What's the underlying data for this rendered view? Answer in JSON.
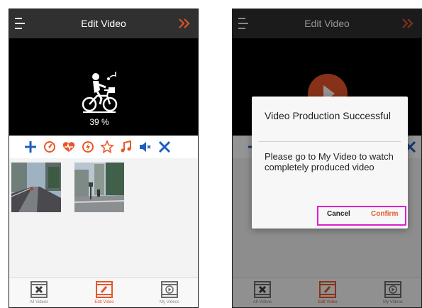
{
  "colors": {
    "accent": "#e8562a",
    "toolbar_blue": "#1f5fbf",
    "topbar": "#303030",
    "highlight": "#e01ed0"
  },
  "left_screen": {
    "header": {
      "title": "Edit Video",
      "menu_icon": "hamburger-icon",
      "next_icon": "double-chevron-right-icon"
    },
    "preview": {
      "progress_icon": "music-bike-icon",
      "progress_text": "39 %",
      "progress_value": 39
    },
    "tools": [
      {
        "icon": "add-icon"
      },
      {
        "icon": "speed-icon"
      },
      {
        "icon": "heartbeat-icon"
      },
      {
        "icon": "flash-icon"
      },
      {
        "icon": "star-icon"
      },
      {
        "icon": "music-note-icon"
      },
      {
        "icon": "mute-icon"
      },
      {
        "icon": "close-icon"
      }
    ],
    "clips": [
      {
        "thumb": "road-video-thumbnail"
      },
      {
        "thumb": "street-video-thumbnail"
      }
    ],
    "bottom_nav": [
      {
        "label": "All Videos",
        "icon": "film-x-icon",
        "active": false
      },
      {
        "label": "Edit Video",
        "icon": "film-edit-icon",
        "active": true
      },
      {
        "label": "My Videos",
        "icon": "film-play-icon",
        "active": false
      }
    ]
  },
  "right_screen": {
    "header": {
      "title": "Edit Video"
    },
    "dialog": {
      "title": "Video Production Successful",
      "message": "Please go to My Video to watch completely produced video",
      "cancel_label": "Cancel",
      "confirm_label": "Confirm"
    },
    "bottom_nav": [
      {
        "label": "All Videos"
      },
      {
        "label": "Edit Video"
      },
      {
        "label": "My Videos"
      }
    ]
  }
}
